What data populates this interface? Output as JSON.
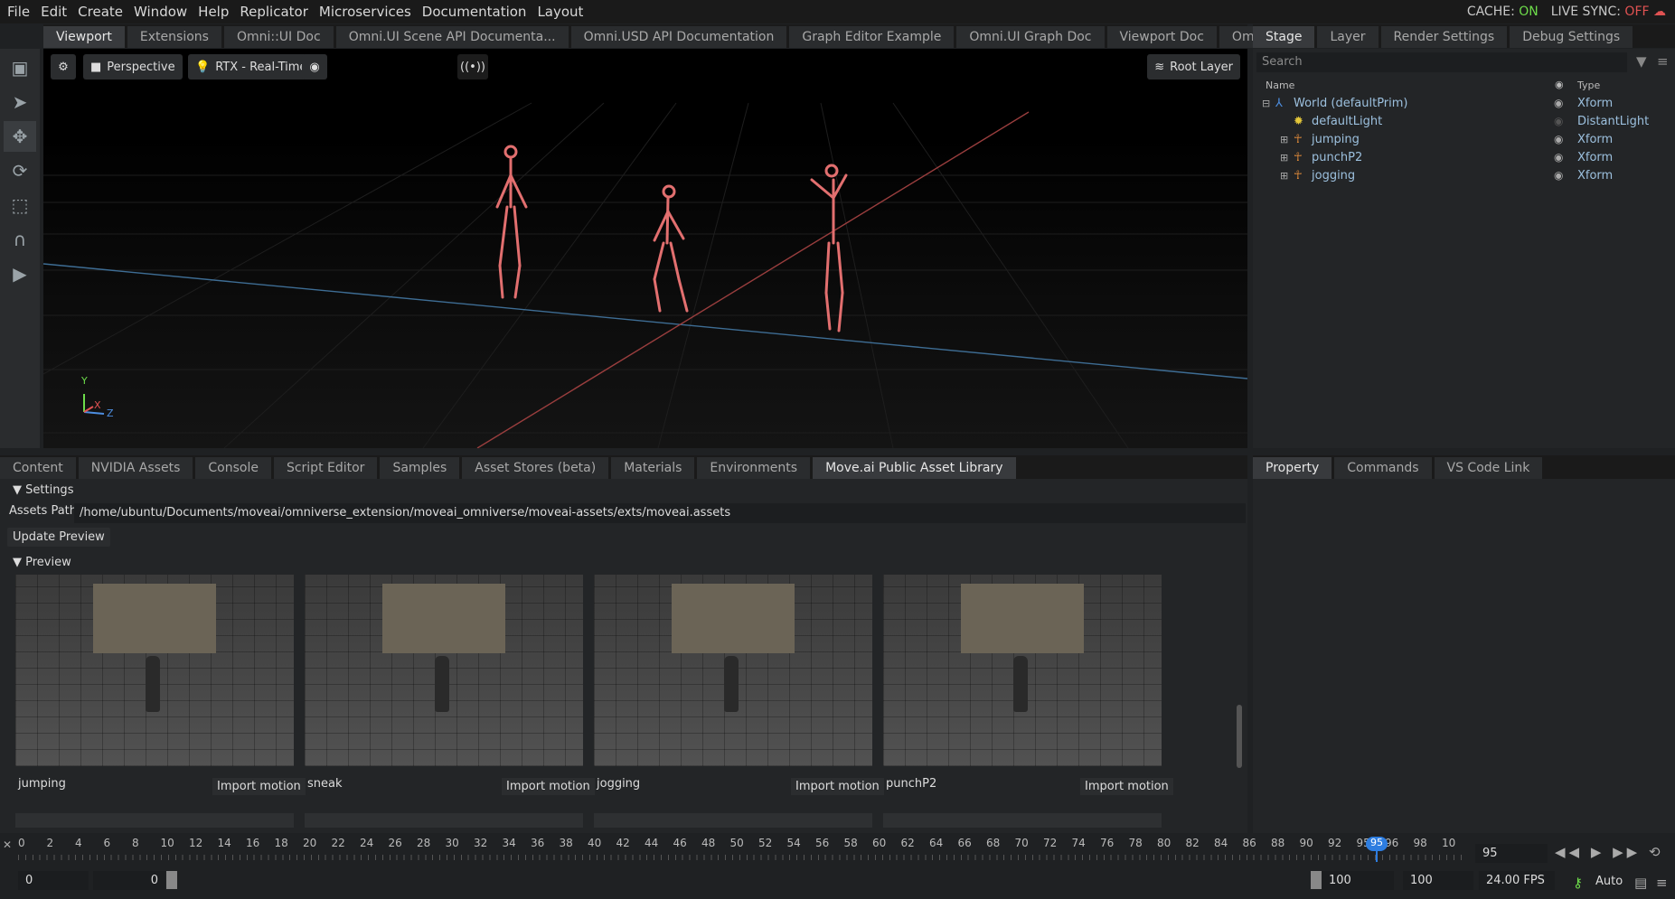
{
  "menu": [
    "File",
    "Edit",
    "Create",
    "Window",
    "Help",
    "Replicator",
    "Microservices",
    "Documentation",
    "Layout"
  ],
  "status": {
    "cache_label": "CACHE:",
    "cache_value": "ON",
    "cache_color": "#6ddc4a",
    "sync_label": "LIVE SYNC:",
    "sync_value": "OFF",
    "sync_color": "#e05252"
  },
  "top_tabs": [
    "Viewport",
    "Extensions",
    "Omni::UI Doc",
    "Omni.UI Scene API Documenta...",
    "Omni.USD API Documentation",
    "Graph Editor Example",
    "Omni.UI Graph Doc",
    "Viewport Doc",
    "Omniverse Code Contest"
  ],
  "viewport": {
    "camera": "Perspective",
    "renderer": "RTX - Real-Time",
    "root_layer": "Root Layer",
    "axis_y": "Y",
    "axis_x": "X",
    "axis_z": "Z"
  },
  "stage_tabs": [
    "Stage",
    "Layer",
    "Render Settings",
    "Debug Settings"
  ],
  "stage": {
    "search_placeholder": "Search",
    "col_name": "Name",
    "col_type": "Type",
    "items": [
      {
        "name": "World (defaultPrim)",
        "type": "Xform"
      },
      {
        "name": "defaultLight",
        "type": "DistantLight"
      },
      {
        "name": "jumping",
        "type": "Xform"
      },
      {
        "name": "punchP2",
        "type": "Xform"
      },
      {
        "name": "jogging",
        "type": "Xform"
      }
    ]
  },
  "bottom_tabs": [
    "Content",
    "NVIDIA Assets",
    "Console",
    "Script Editor",
    "Samples",
    "Asset Stores (beta)",
    "Materials",
    "Environments",
    "Move.ai Public Asset Library"
  ],
  "prop_tabs": [
    "Property",
    "Commands",
    "VS Code Link"
  ],
  "library": {
    "settings": "Settings",
    "assets_path_label": "Assets Path",
    "assets_path": "/home/ubuntu/Documents/moveai/omniverse_extension/moveai_omniverse/moveai-assets/exts/moveai.assets",
    "update_button": "Update Preview",
    "preview": "Preview",
    "import_label": "Import motion",
    "cards": [
      {
        "name": "jumping"
      },
      {
        "name": "sneak"
      },
      {
        "name": "jogging"
      },
      {
        "name": "punchP2"
      }
    ]
  },
  "timeline": {
    "ticks": [
      "0",
      "2",
      "4",
      "6",
      "8",
      "10",
      "12",
      "14",
      "16",
      "18",
      "20",
      "22",
      "24",
      "26",
      "28",
      "30",
      "32",
      "34",
      "36",
      "38",
      "40",
      "42",
      "44",
      "46",
      "48",
      "50",
      "52",
      "54",
      "56",
      "58",
      "60",
      "62",
      "64",
      "66",
      "68",
      "70",
      "72",
      "74",
      "76",
      "78",
      "80",
      "82",
      "84",
      "86",
      "88",
      "90",
      "92",
      "95",
      "96",
      "98",
      "10"
    ],
    "current": "95",
    "start": "0",
    "range_start": "0",
    "range_end": "100",
    "end": "100",
    "fps": "24.00 FPS",
    "auto": "Auto"
  }
}
